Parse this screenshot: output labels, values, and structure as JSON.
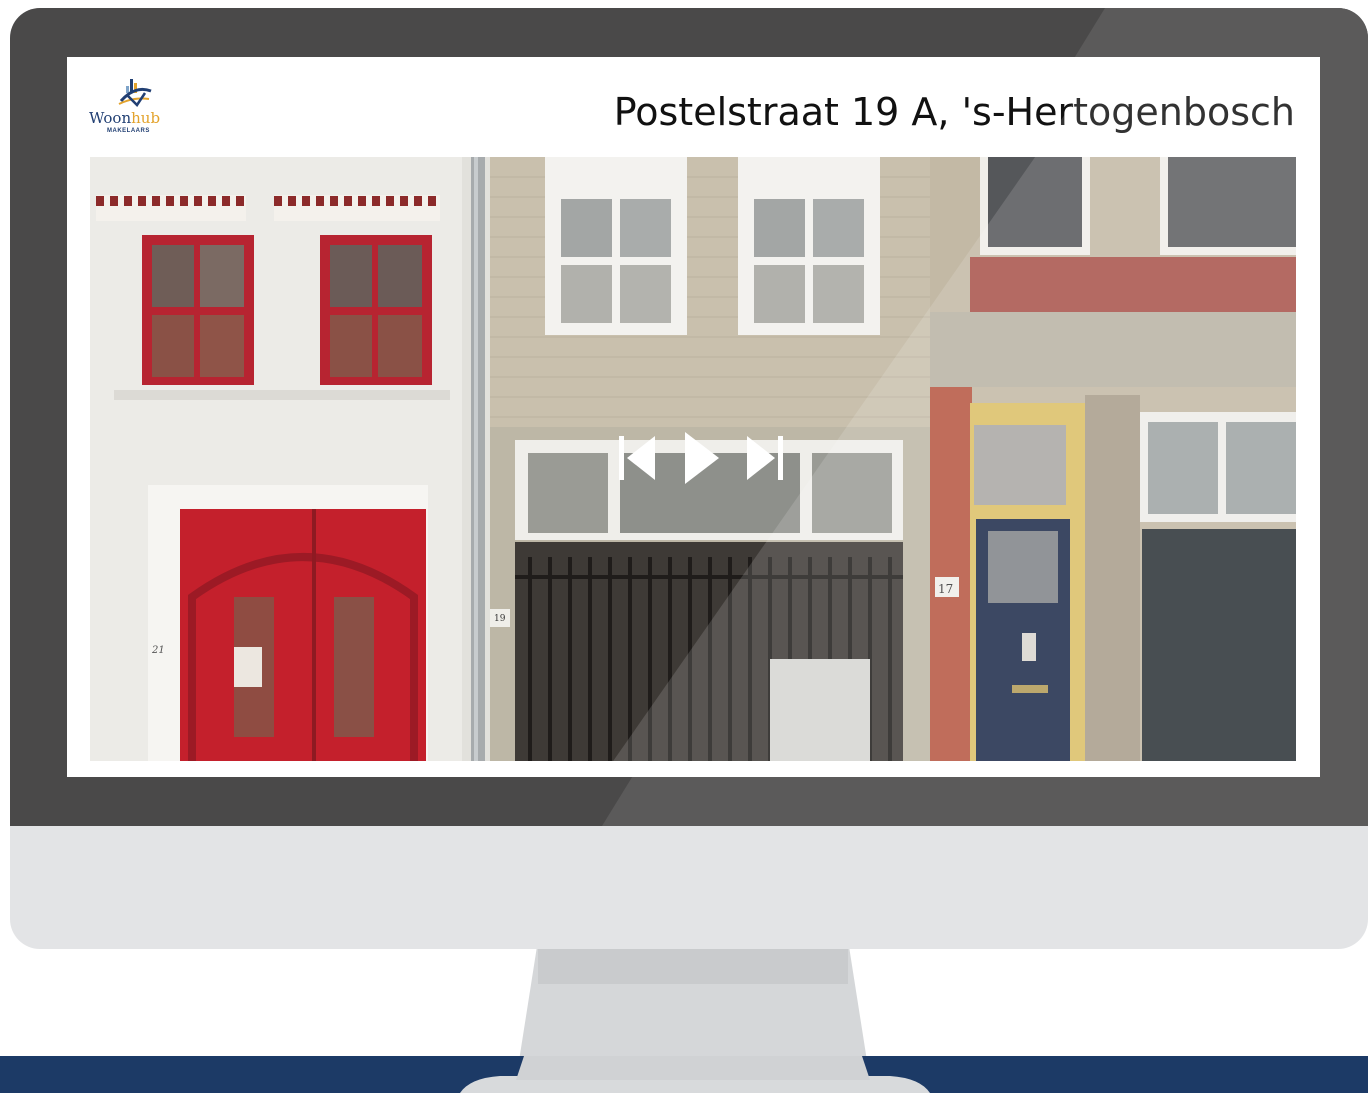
{
  "listing": {
    "address": "Postelstraat 19 A, 's-Hertogenbosch"
  },
  "brand": {
    "name_part1": "Woon",
    "name_part2": "hub",
    "subtitle": "MAKELAARS",
    "primary_color": "#213f73",
    "accent_color": "#e3a32c"
  },
  "slideshow": {
    "controls": [
      "skip-back-icon",
      "play-icon",
      "skip-forward-icon"
    ],
    "photo_house_numbers": [
      "21",
      "19",
      "17"
    ]
  },
  "colors": {
    "bezel": "#4a4949",
    "monitor_chin": "#e3e4e6",
    "footer_band": "#1c3a66"
  }
}
